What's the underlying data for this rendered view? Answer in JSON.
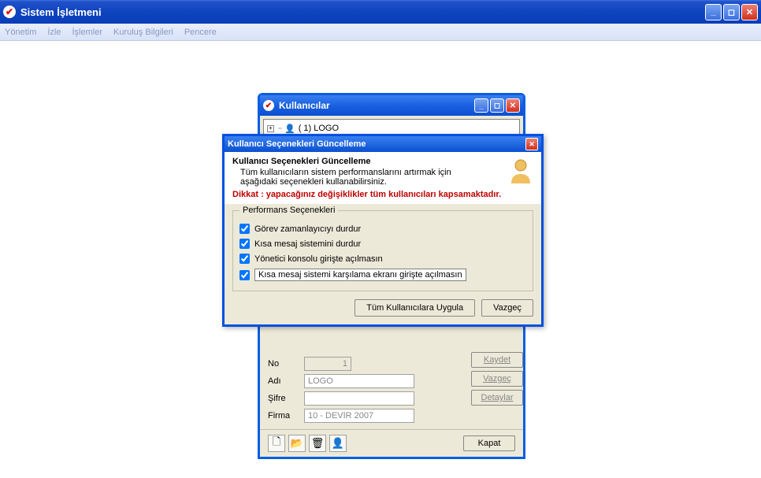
{
  "main": {
    "title": "Sistem İşletmeni"
  },
  "menu": {
    "yonetim": "Yönetim",
    "izle": "İzle",
    "islemler": "İşlemler",
    "kurulus": "Kuruluş Bilgileri",
    "pencere": "Pencere"
  },
  "users_window": {
    "title": "Kullanıcılar",
    "tree_item": "( 1) LOGO",
    "labels": {
      "no": "No",
      "adi": "Adı",
      "sifre": "Şifre",
      "firma": "Firma"
    },
    "values": {
      "no": "1",
      "adi": "LOGO",
      "sifre": "",
      "firma": "10 - DEVİR 2007"
    },
    "buttons": {
      "kaydet": "Kaydet",
      "vazgec": "Vazgeç",
      "detaylar": "Detaylar",
      "kapat": "Kapat"
    }
  },
  "dialog": {
    "title": "Kullanıcı Seçenekleri Güncelleme",
    "heading": "Kullanıcı Seçenekleri Güncelleme",
    "desc1": "Tüm kullanıcıların sistem performanslarını artırmak için",
    "desc2": "aşağıdaki seçenekleri kullanabilirsiniz.",
    "warning": "Dikkat : yapacağınız değişiklikler tüm kullanıcıları kapsamaktadır.",
    "group_title": "Performans Seçenekleri",
    "opts": {
      "o1": "Görev zamanlayıcıyı durdur",
      "o2": "Kısa mesaj sistemini durdur",
      "o3": "Yönetici konsolu girişte açılmasın",
      "o4": "Kısa mesaj sistemi karşılama ekranı girişte açılmasın"
    },
    "buttons": {
      "apply": "Tüm Kullanıcılara Uygula",
      "cancel": "Vazgeç"
    }
  }
}
